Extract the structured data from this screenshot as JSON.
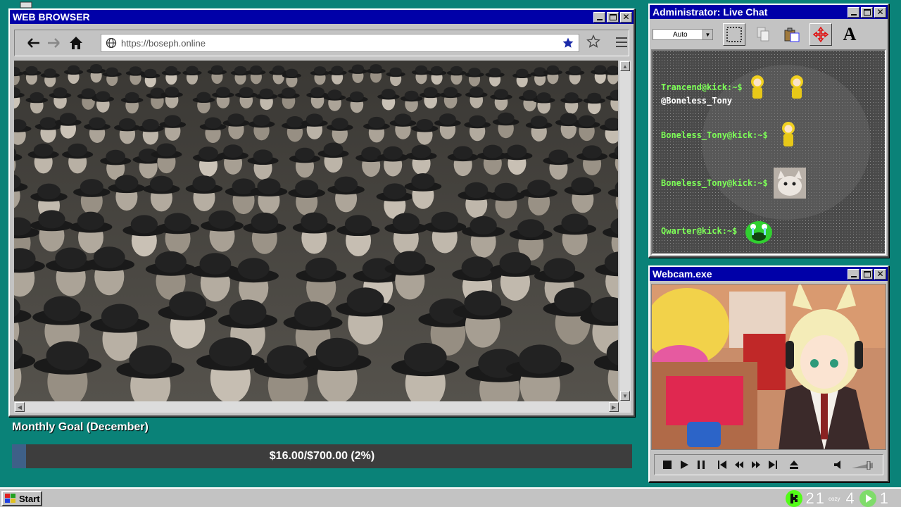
{
  "browser": {
    "title": "WEB BROWSER",
    "url": "https://boseph.online"
  },
  "goal": {
    "title": "Monthly Goal (December)",
    "text": "$16.00/$700.00 (2%)",
    "progress": 0.0229
  },
  "chat": {
    "title": "Administrator: Live Chat",
    "select_value": "Auto",
    "messages": [
      {
        "user": "Trancend@kick:~$",
        "text": ""
      },
      {
        "user": "",
        "text": "@Boneless_Tony"
      },
      {
        "user": "Boneless_Tony@kick:~$",
        "text": ""
      },
      {
        "user": "Boneless_Tony@kick:~$",
        "text": ""
      },
      {
        "user": "Qwarter@kick:~$",
        "text": ""
      }
    ]
  },
  "webcam": {
    "title": "Webcam.exe"
  },
  "taskbar": {
    "start_label": "Start",
    "count_a": "2",
    "count_b": "1",
    "cozy_label": "cozy",
    "count_c": "4",
    "count_d": "1"
  },
  "colors": {
    "desktop": "#0a8278",
    "titlebar": "#0000a8",
    "chat_user": "#7dff57",
    "goal_fill": "#3e6088"
  }
}
